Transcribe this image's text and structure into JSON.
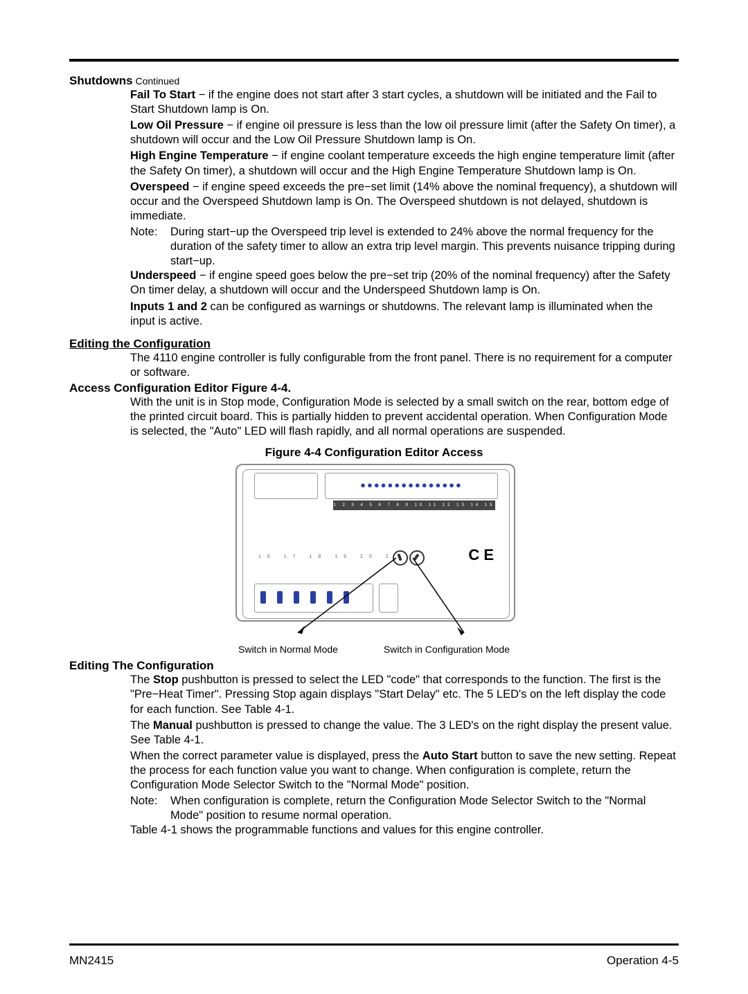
{
  "shutdowns": {
    "heading": "Shutdowns",
    "continued": " Continued",
    "fail_to_start_label": "Fail To Start",
    "fail_to_start_text": " −  if the engine does not start after 3 start cycles, a shutdown will be initiated and the Fail to Start Shutdown lamp is On.",
    "low_oil_label": "Low Oil Pressure",
    "low_oil_text": " −  if engine oil pressure is less than the low oil pressure limit (after the Safety On timer), a shutdown will occur and the Low Oil Pressure Shutdown lamp is On.",
    "high_temp_label": "High Engine Temperature",
    "high_temp_text": " −  if engine coolant temperature exceeds the high engine temperature limit (after the Safety On timer), a shutdown will occur and the High Engine Temperature Shutdown lamp is On.",
    "overspeed_label": "Overspeed",
    "overspeed_text": " −  if engine speed exceeds the pre−set limit (14% above the nominal frequency), a shutdown will occur and the Overspeed Shutdown lamp is On.  The Overspeed shutdown is not delayed, shutdown is immediate.",
    "overspeed_note_label": "Note:",
    "overspeed_note_text": "During start−up the Overspeed trip level is extended to 24% above the normal frequency for the duration of the safety timer to allow an extra trip level margin. This prevents nuisance tripping during start−up.",
    "underspeed_label": "Underspeed",
    "underspeed_text": " −  if engine speed goes below the pre−set trip (20% of the nominal frequency) after the Safety On timer delay, a shutdown will occur and the Underspeed Shutdown lamp is On.",
    "inputs_label": "Inputs 1 and 2",
    "inputs_text": " can be configured as warnings or shutdowns. The relevant lamp is illuminated when the input is active."
  },
  "editing": {
    "heading": "Editing the Configuration",
    "intro": "The 4110 engine controller is fully configurable from the front panel. There is no requirement for a computer or software.",
    "access_heading": "Access Configuration Editor",
    "access_ref": "  Figure 4-4.",
    "access_text": "With the unit is in Stop  mode, Configuration Mode is selected by a small switch on the rear, bottom edge of the printed circuit board.  This is partially hidden to prevent accidental operation.  When Configuration Mode is selected, the \"Auto\" LED will flash rapidly, and all normal operations are suspended.",
    "fig_caption": "Figure 4-4  Configuration Editor Access",
    "fig_left_label": "Switch in Normal Mode",
    "fig_right_label": "Switch in Configuration Mode",
    "edit_heading": "Editing The Configuration",
    "p1_a": "The ",
    "p1_stop": "Stop",
    "p1_b": "  pushbutton is pressed to select the LED \"code\" that corresponds to the function.  The first is the \"Pre−Heat Timer\". Pressing Stop again displays \"Start Delay\" etc.  The 5 LED's on the left display the code for each function.  See Table 4-1.",
    "p2_a": "The ",
    "p2_manual": "Manual",
    "p2_b": "  pushbutton is pressed to change the value. The 3 LED's on the right display the present value.  See Table 4-1.",
    "p3_a": "When the correct parameter value is displayed, press the ",
    "p3_auto": "Auto Start",
    "p3_b": " button to save the new setting. Repeat the process for each function value you want to change. When configuration is complete, return the Configuration Mode Selector Switch to the \"Normal Mode\" position.",
    "p3_note_label": "Note:",
    "p3_note_text": "When configuration is complete, return the Configuration Mode Selector Switch to the \"Normal Mode\" position to resume normal operation.",
    "p4": "Table 4-1 shows the programmable functions and values for this engine controller."
  },
  "figure": {
    "top_numbers": "1 2 3 4 5 6 7 8 9 10 11 12 13 14 15",
    "bottom_numbers": "16  17  18  19  20  21",
    "ce": "C E",
    "dots": "●●●●●●●●●●●●●●●"
  },
  "footer": {
    "left": "MN2415",
    "right": "Operation  4-5"
  }
}
